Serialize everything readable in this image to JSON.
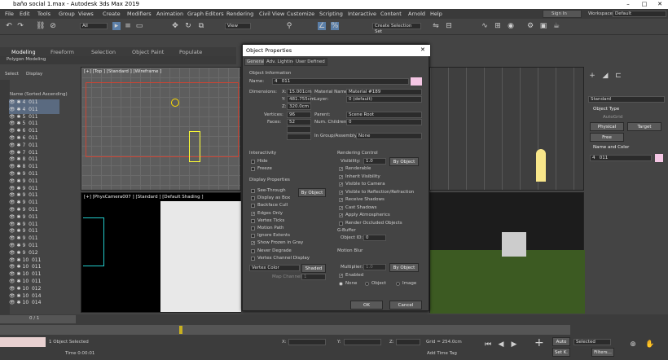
{
  "window": {
    "title": "baño social 1.max - Autodesk 3ds Max 2019"
  },
  "menu": [
    "File",
    "Edit",
    "Tools",
    "Group",
    "Views",
    "Create",
    "Modifiers",
    "Animation",
    "Graph Editors",
    "Rendering",
    "Civil View",
    "Customize",
    "Scripting",
    "Interactive",
    "Content",
    "Arnold",
    "Help"
  ],
  "account": {
    "signin": "Sign In",
    "workspaces_label": "Workspaces:",
    "workspace": "Default"
  },
  "toolbar": {
    "filter": "All",
    "view": "View",
    "selection_set": "Create Selection Set"
  },
  "ribbon": {
    "tabs": [
      "Modeling",
      "Freeform",
      "Selection",
      "Object Paint",
      "Populate"
    ],
    "sub": "Polygon Modeling"
  },
  "scene_explorer": {
    "select": "Select",
    "display": "Display",
    "header": "Name (Sorted Ascending)",
    "rows": [
      {
        "n": "4",
        "v": "011"
      },
      {
        "n": "4",
        "v": "011"
      },
      {
        "n": "5",
        "v": "011"
      },
      {
        "n": "5",
        "v": "011"
      },
      {
        "n": "6",
        "v": "011"
      },
      {
        "n": "6",
        "v": "011"
      },
      {
        "n": "7",
        "v": "011"
      },
      {
        "n": "7",
        "v": "011"
      },
      {
        "n": "8",
        "v": "011"
      },
      {
        "n": "8",
        "v": "011"
      },
      {
        "n": "9",
        "v": "011"
      },
      {
        "n": "9",
        "v": "011"
      },
      {
        "n": "9",
        "v": "011"
      },
      {
        "n": "9",
        "v": "011"
      },
      {
        "n": "9",
        "v": "011"
      },
      {
        "n": "9",
        "v": "011"
      },
      {
        "n": "9",
        "v": "011"
      },
      {
        "n": "9",
        "v": "011"
      },
      {
        "n": "9",
        "v": "011"
      },
      {
        "n": "9",
        "v": "011"
      },
      {
        "n": "9",
        "v": "011"
      },
      {
        "n": "9",
        "v": "012"
      },
      {
        "n": "10",
        "v": "011"
      },
      {
        "n": "10",
        "v": "011"
      },
      {
        "n": "10",
        "v": "011"
      },
      {
        "n": "10",
        "v": "011"
      },
      {
        "n": "10",
        "v": "012"
      },
      {
        "n": "10",
        "v": "014"
      },
      {
        "n": "10",
        "v": "014"
      }
    ]
  },
  "viewports": {
    "top": "[+] [Top ] [Standard ] [Wireframe ]",
    "camera": "[+] [PhysCamera007 ] [Standard ] [Default Shading ]"
  },
  "dialog": {
    "title": "Object Properties",
    "tabs": [
      "General",
      "Adv. Lighting",
      "User Defined"
    ],
    "object_info": "Object Information",
    "name_label": "Name:",
    "name_a": "4",
    "name_b": "011",
    "dimensions": "Dimensions:",
    "x_label": "X:",
    "x": "15.001cm",
    "y_label": "Y:",
    "y": "481.755cm",
    "z_label": "Z:",
    "z": "320.0cm",
    "material_name_label": "Material Name:",
    "material_name": "Material #189",
    "layer_label": "Layer:",
    "layer": "0 (default)",
    "vertices_label": "Vertices:",
    "vertices": "96",
    "faces_label": "Faces:",
    "faces": "52",
    "parent_label": "Parent:",
    "parent": "Scene Root",
    "children_label": "Num. Children:",
    "children": "0",
    "group_label": "In Group/Assembly:",
    "group": "None",
    "interactivity": "Interactivity",
    "hide": "Hide",
    "freeze": "Freeze",
    "display_props": "Display Properties",
    "by_object": "By Object",
    "display_opts": [
      {
        "l": "See-Through",
        "c": false
      },
      {
        "l": "Display as Box",
        "c": false
      },
      {
        "l": "Backface Cull",
        "c": false
      },
      {
        "l": "Edges Only",
        "c": true
      },
      {
        "l": "Vertex Ticks",
        "c": false
      },
      {
        "l": "Motion Path",
        "c": false
      },
      {
        "l": "Ignore Extents",
        "c": false
      },
      {
        "l": "Show Frozen in Gray",
        "c": true
      },
      {
        "l": "Never Degrade",
        "c": false
      },
      {
        "l": "Vertex Channel Display",
        "c": false
      }
    ],
    "vertex_color": "Vertex Color",
    "shaded": "Shaded",
    "map_channel": "Map Channel:",
    "map_channel_val": "1",
    "rendering_control": "Rendering Control",
    "visibility_label": "Visibility:",
    "visibility": "1.0",
    "render_opts": [
      {
        "l": "Renderable",
        "c": true
      },
      {
        "l": "Inherit Visibility",
        "c": true
      },
      {
        "l": "Visible to Camera",
        "c": true
      },
      {
        "l": "Visible to Reflection/Refraction",
        "c": true
      },
      {
        "l": "Receive Shadows",
        "c": true
      },
      {
        "l": "Cast Shadows",
        "c": true
      },
      {
        "l": "Apply Atmospherics",
        "c": true
      },
      {
        "l": "Render Occluded Objects",
        "c": false
      }
    ],
    "gbuffer": "G-Buffer",
    "object_id_label": "Object ID:",
    "object_id": "0",
    "motion_blur": "Motion Blur",
    "multiplier_label": "Multiplier:",
    "multiplier": "1.0",
    "enabled": "Enabled",
    "none": "None",
    "object": "Object",
    "image": "Image",
    "ok": "OK",
    "cancel": "Cancel"
  },
  "command_panel": {
    "modifier": "Standard",
    "object_type": "Object Type",
    "autogrid": "AutoGrid",
    "physical": "Physical",
    "target": "Target",
    "free": "Free",
    "name_color": "Name and Color",
    "obj_name": "4",
    "obj_name_b": "011"
  },
  "status": {
    "frames": "0 / 1",
    "selected": "1 Object Selected",
    "time": "Time  0:00:01",
    "grid": "Grid = 254.0cm",
    "add_time_tag": "Add Time Tag",
    "auto": "Auto",
    "selected_key": "Selected",
    "set_k": "Set K.",
    "filters": "Filters...",
    "x_label": "X:",
    "y_label": "Y:",
    "z_label": "Z:"
  }
}
